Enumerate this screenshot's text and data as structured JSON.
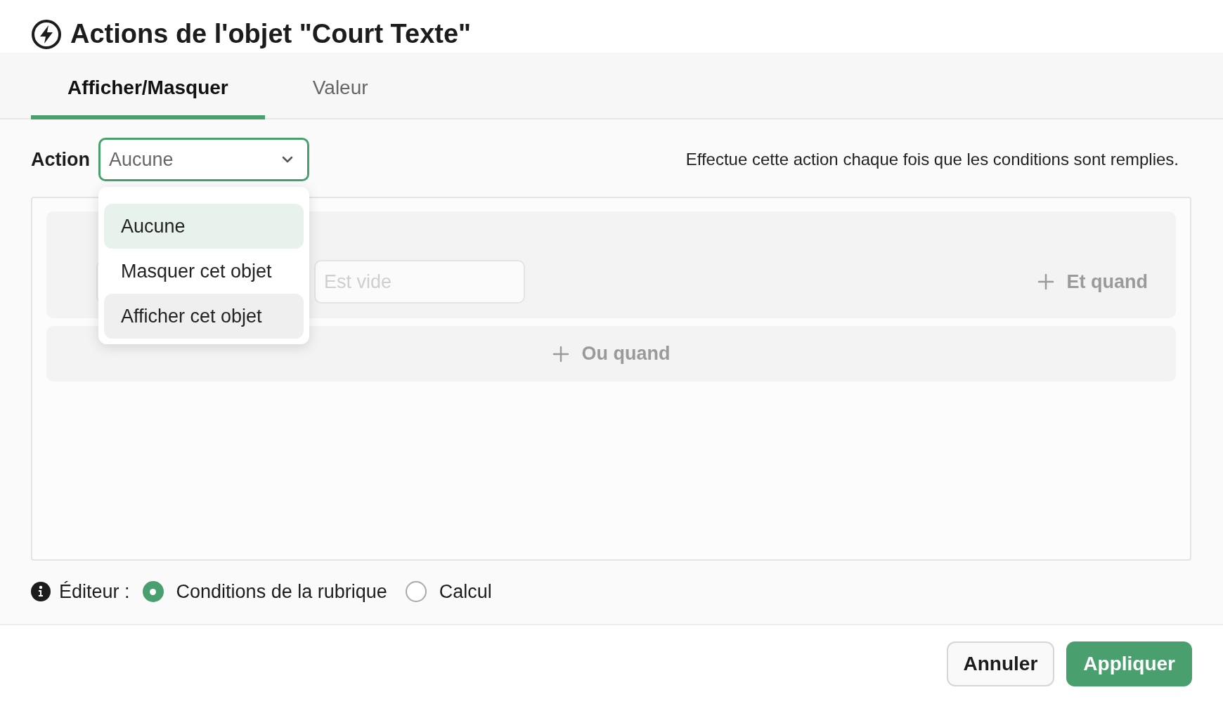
{
  "title": "Actions de l'objet \"Court Texte\"",
  "tabs": [
    {
      "label": "Afficher/Masquer",
      "selected": true
    },
    {
      "label": "Valeur",
      "selected": false
    }
  ],
  "action": {
    "label": "Action",
    "value": "Aucune",
    "open": true,
    "description": "Effectue cette action chaque fois que les conditions sont remplies."
  },
  "dropdown": {
    "options": [
      {
        "label": "Aucune",
        "selected": true,
        "hovered": false
      },
      {
        "label": "Masquer cet objet",
        "selected": false,
        "hovered": false
      },
      {
        "label": "Afficher cet objet",
        "selected": false,
        "hovered": true
      }
    ]
  },
  "conditions": {
    "value_placeholder": "Est vide",
    "and_button": "Et quand",
    "or_button": "Ou quand"
  },
  "editor": {
    "label": "Éditeur :",
    "options": [
      {
        "label": "Conditions de la rubrique",
        "selected": true
      },
      {
        "label": "Calcul",
        "selected": false
      }
    ]
  },
  "buttons": [
    {
      "label": "Annuler",
      "kind": "secondary"
    },
    {
      "label": "Appliquer",
      "kind": "primary"
    }
  ]
}
